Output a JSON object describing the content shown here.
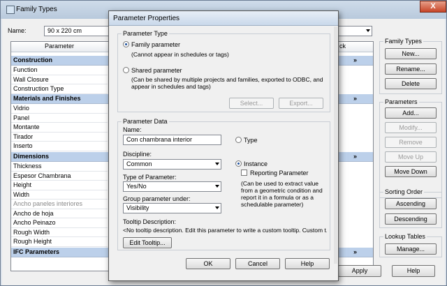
{
  "family_types": {
    "title": "Family Types",
    "close_glyph": "X",
    "name_label": "Name:",
    "name_value": "90 x 220 cm",
    "col_parameter": "Parameter",
    "col_lock": "ck",
    "groups": {
      "construction": "Construction",
      "materials": "Materials and Finishes",
      "dimensions": "Dimensions",
      "ifc": "IFC Parameters"
    },
    "chevron": "»",
    "rows": {
      "function": "Function",
      "wall_closure": "Wall Closure",
      "construction_type": "Construction Type",
      "vidrio": "Vidrio",
      "panel": "Panel",
      "montante": "Montante",
      "tirador": "Tirador",
      "inserto": "Inserto",
      "thickness": "Thickness",
      "espesor": "Espesor Chambrana",
      "height": "Height",
      "width": "Width",
      "ancho_paneles": "Ancho paneles interiores",
      "ancho_hoja": "Ancho de hoja",
      "ancho_peinazo": "Ancho Peinazo",
      "rough_width": "Rough Width",
      "rough_height": "Rough Height"
    },
    "family_types_box": {
      "caption": "Family Types",
      "new": "New...",
      "rename": "Rename...",
      "delete": "Delete"
    },
    "parameters_box": {
      "caption": "Parameters",
      "add": "Add...",
      "modify": "Modify...",
      "remove": "Remove",
      "move_up": "Move Up",
      "move_down": "Move Down"
    },
    "sorting_box": {
      "caption": "Sorting Order",
      "ascending": "Ascending",
      "descending": "Descending"
    },
    "lookup_box": {
      "caption": "Lookup Tables",
      "manage": "Manage..."
    },
    "apply": "Apply",
    "help": "Help"
  },
  "parameter_properties": {
    "title": "Parameter Properties",
    "type_group": "Parameter Type",
    "family_param": "Family parameter",
    "family_param_desc": "(Cannot appear in schedules or tags)",
    "shared_param": "Shared parameter",
    "shared_param_desc": "(Can be shared by multiple projects and families, exported to ODBC, and appear in schedules and tags)",
    "select": "Select...",
    "export": "Export...",
    "data_group": "Parameter Data",
    "name_label": "Name:",
    "name_value": "Con chambrana interior",
    "type_radio": "Type",
    "discipline_label": "Discipline:",
    "discipline_value": "Common",
    "instance_radio": "Instance",
    "type_of_param_label": "Type of Parameter:",
    "type_of_param_value": "Yes/No",
    "reporting": "Reporting Parameter",
    "reporting_desc": "(Can be used to extract value from a geometric condition and report it in a formula or as a schedulable parameter)",
    "group_under_label": "Group parameter under:",
    "group_under_value": "Visibility",
    "tooltip_label": "Tooltip Description:",
    "tooltip_value": "<No tooltip description. Edit this parameter to write a custom tooltip. Custom t...",
    "edit_tooltip": "Edit Tooltip...",
    "ok": "OK",
    "cancel": "Cancel",
    "help": "Help"
  }
}
